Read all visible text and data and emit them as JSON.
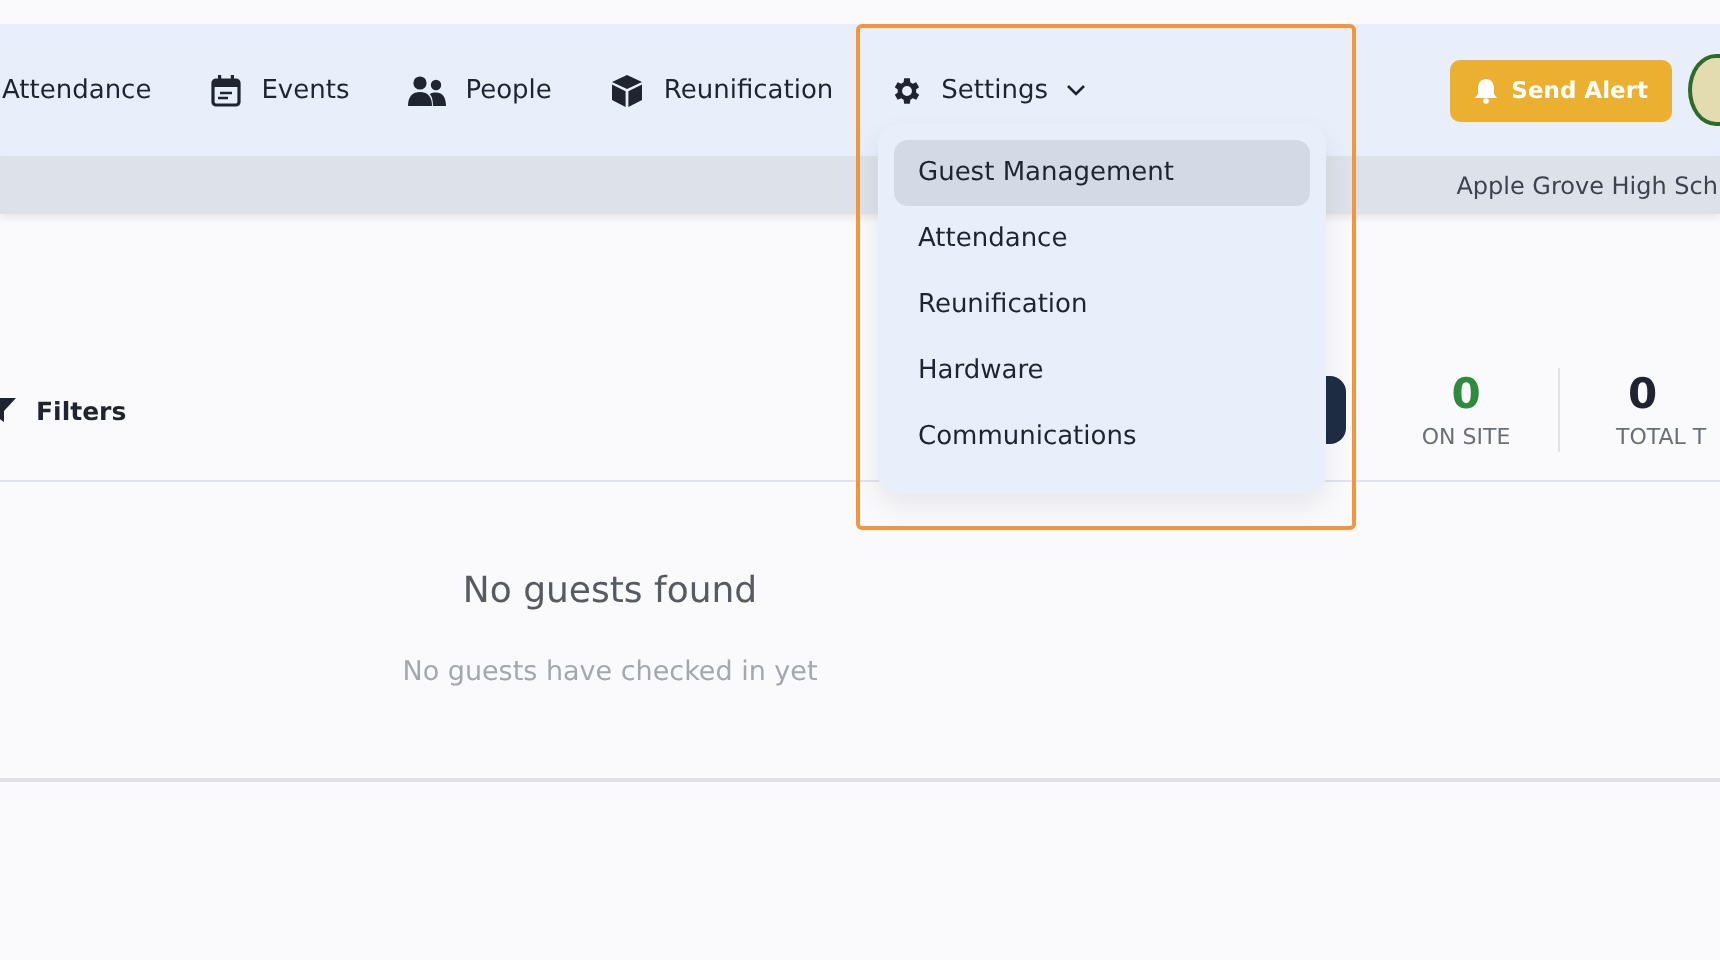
{
  "nav": {
    "items": [
      {
        "label": "Attendance"
      },
      {
        "label": "Events"
      },
      {
        "label": "People"
      },
      {
        "label": "Reunification"
      }
    ],
    "settings": {
      "label": "Settings",
      "expanded": true,
      "menu": [
        {
          "label": "Guest Management",
          "selected": true
        },
        {
          "label": "Attendance",
          "selected": false
        },
        {
          "label": "Reunification",
          "selected": false
        },
        {
          "label": "Hardware",
          "selected": false
        },
        {
          "label": "Communications",
          "selected": false
        }
      ]
    },
    "alert_button": "Send Alert"
  },
  "school": "Apple Grove High Sch",
  "toolbar": {
    "filters": "Filters",
    "stats": [
      {
        "value": "0",
        "label": "ON SITE",
        "color": "#2e8b3e"
      },
      {
        "value": "0",
        "label": "TOTAL T",
        "color": "#1f2430"
      }
    ]
  },
  "empty": {
    "title": "No guests found",
    "message": "No guests have checked in yet"
  }
}
